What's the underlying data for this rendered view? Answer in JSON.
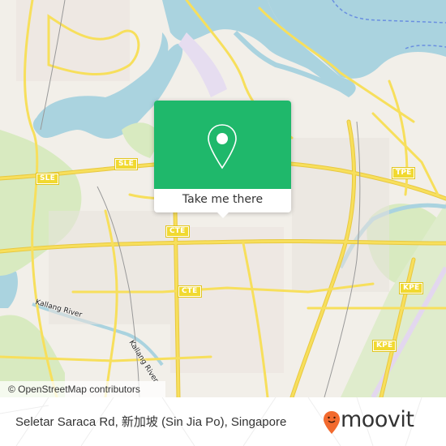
{
  "map": {
    "attribution": "© OpenStreetMap contributors",
    "colors": {
      "land": "#f2efe9",
      "water": "#aad3df",
      "park": "#d8eac0",
      "road_major": "#f7df5c",
      "road_casing": "#e8c840",
      "popup_green": "#1fb86b",
      "moovit_orange": "#f26a2e"
    },
    "road_shields": [
      {
        "label": "SLE",
        "name": "shield-sle-1"
      },
      {
        "label": "SLE",
        "name": "shield-sle-2"
      },
      {
        "label": "CTE",
        "name": "shield-cte-1"
      },
      {
        "label": "CTE",
        "name": "shield-cte-2"
      },
      {
        "label": "TPE",
        "name": "shield-tpe"
      },
      {
        "label": "KPE",
        "name": "shield-kpe-1"
      },
      {
        "label": "KPE",
        "name": "shield-kpe-2"
      }
    ],
    "river_labels": [
      "Kallang River",
      "Kallang River"
    ]
  },
  "popup": {
    "icon": "map-pin-icon",
    "button_label": "Take me there"
  },
  "footer": {
    "address": "Seletar Saraca Rd, 新加坡 (Sin Jia Po), Singapore",
    "brand": "moovit",
    "logo_icon": "moovit-smiley-pin-icon"
  }
}
